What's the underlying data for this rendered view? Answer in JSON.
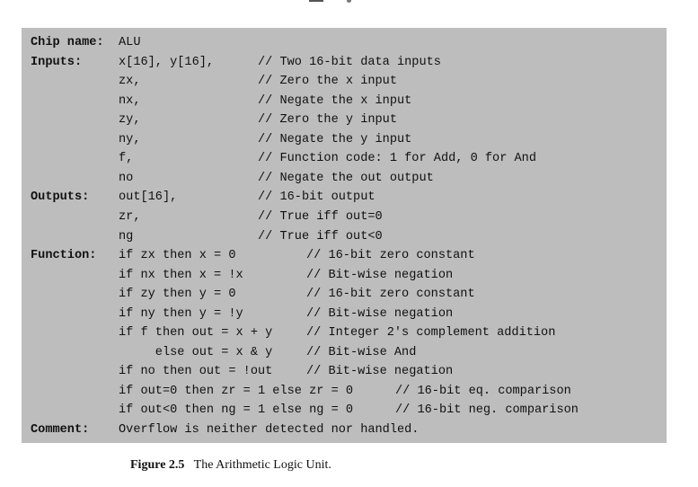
{
  "spec": {
    "lines": [
      {
        "label": "Chip name:",
        "code": "ALU",
        "comment": "",
        "comment_col": 0
      },
      {
        "label": "Inputs:",
        "code": "x[16], y[16],",
        "comment": "// Two 16-bit data inputs",
        "comment_col": 0
      },
      {
        "label": "",
        "code": "zx,",
        "comment": "// Zero the x input",
        "comment_col": 0
      },
      {
        "label": "",
        "code": "nx,",
        "comment": "// Negate the x input",
        "comment_col": 0
      },
      {
        "label": "",
        "code": "zy,",
        "comment": "// Zero the y input",
        "comment_col": 0
      },
      {
        "label": "",
        "code": "ny,",
        "comment": "// Negate the y input",
        "comment_col": 0
      },
      {
        "label": "",
        "code": "f,",
        "comment": "// Function code: 1 for Add, 0 for And",
        "comment_col": 0
      },
      {
        "label": "",
        "code": "no",
        "comment": "// Negate the out output",
        "comment_col": 0
      },
      {
        "label": "Outputs:",
        "code": "out[16],",
        "comment": "// 16-bit output",
        "comment_col": 0
      },
      {
        "label": "",
        "code": "zr,",
        "comment": "// True iff out=0",
        "comment_col": 0
      },
      {
        "label": "",
        "code": "ng",
        "comment": "// True iff out<0",
        "comment_col": 0
      },
      {
        "label": "Function:",
        "code": "if zx then x = 0",
        "comment": "// 16-bit zero constant",
        "comment_col": 1
      },
      {
        "label": "",
        "code": "if nx then x = !x",
        "comment": "// Bit-wise negation",
        "comment_col": 1
      },
      {
        "label": "",
        "code": "if zy then y = 0",
        "comment": "// 16-bit zero constant",
        "comment_col": 1
      },
      {
        "label": "",
        "code": "if ny then y = !y",
        "comment": "// Bit-wise negation",
        "comment_col": 1
      },
      {
        "label": "",
        "code": "if f then out = x + y",
        "comment": "// Integer 2's complement addition",
        "comment_col": 1
      },
      {
        "label": "",
        "code": "     else out = x & y",
        "comment": "// Bit-wise And",
        "comment_col": 1
      },
      {
        "label": "",
        "code": "if no then out = !out",
        "comment": "// Bit-wise negation",
        "comment_col": 1
      },
      {
        "label": "",
        "code": "if out=0 then zr = 1 else zr = 0",
        "comment": "// 16-bit eq. comparison",
        "comment_col": 2
      },
      {
        "label": "",
        "code": "if out<0 then ng = 1 else ng = 0",
        "comment": "// 16-bit neg. comparison",
        "comment_col": 2
      },
      {
        "label": "Comment:",
        "code": "Overflow is neither detected nor handled.",
        "comment": "",
        "comment_col": 0
      }
    ]
  },
  "caption": {
    "figure_number": "Figure 2.5",
    "text": "The Arithmetic Logic Unit."
  }
}
